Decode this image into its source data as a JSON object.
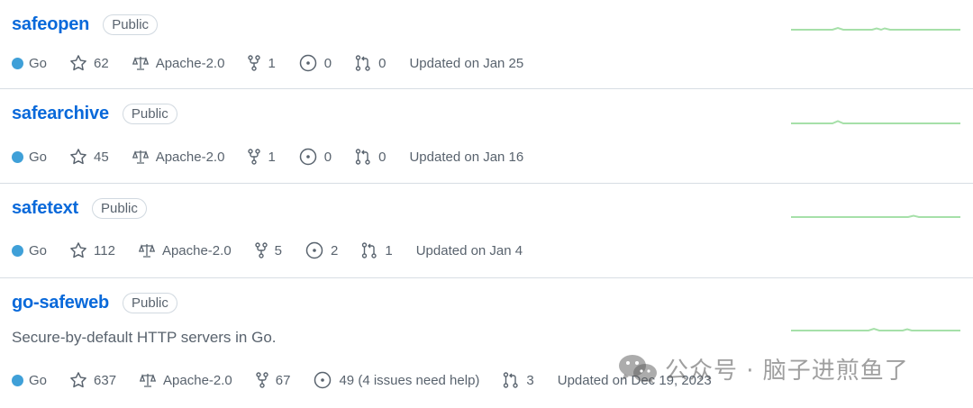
{
  "colors": {
    "link": "#0969da",
    "muted": "#59636e",
    "go": "#3fa0d8",
    "spark": "#a6e0a9"
  },
  "repos": [
    {
      "name": "safeopen",
      "visibility": "Public",
      "description": "",
      "language": "Go",
      "stars": "62",
      "license": "Apache-2.0",
      "forks": "1",
      "issues": "0",
      "pulls": "0",
      "updated": "Updated on Jan 25"
    },
    {
      "name": "safearchive",
      "visibility": "Public",
      "description": "",
      "language": "Go",
      "stars": "45",
      "license": "Apache-2.0",
      "forks": "1",
      "issues": "0",
      "pulls": "0",
      "updated": "Updated on Jan 16"
    },
    {
      "name": "safetext",
      "visibility": "Public",
      "description": "",
      "language": "Go",
      "stars": "112",
      "license": "Apache-2.0",
      "forks": "5",
      "issues": "2",
      "pulls": "1",
      "updated": "Updated on Jan 4"
    },
    {
      "name": "go-safeweb",
      "visibility": "Public",
      "description": "Secure-by-default HTTP servers in Go.",
      "language": "Go",
      "stars": "637",
      "license": "Apache-2.0",
      "forks": "67",
      "issues": "49 (4 issues need help)",
      "pulls": "3",
      "updated": "Updated on Dec 19, 2023"
    }
  ],
  "watermark": {
    "text": "公众号 · 脑子进煎鱼了",
    "icon": "wechat-icon"
  }
}
